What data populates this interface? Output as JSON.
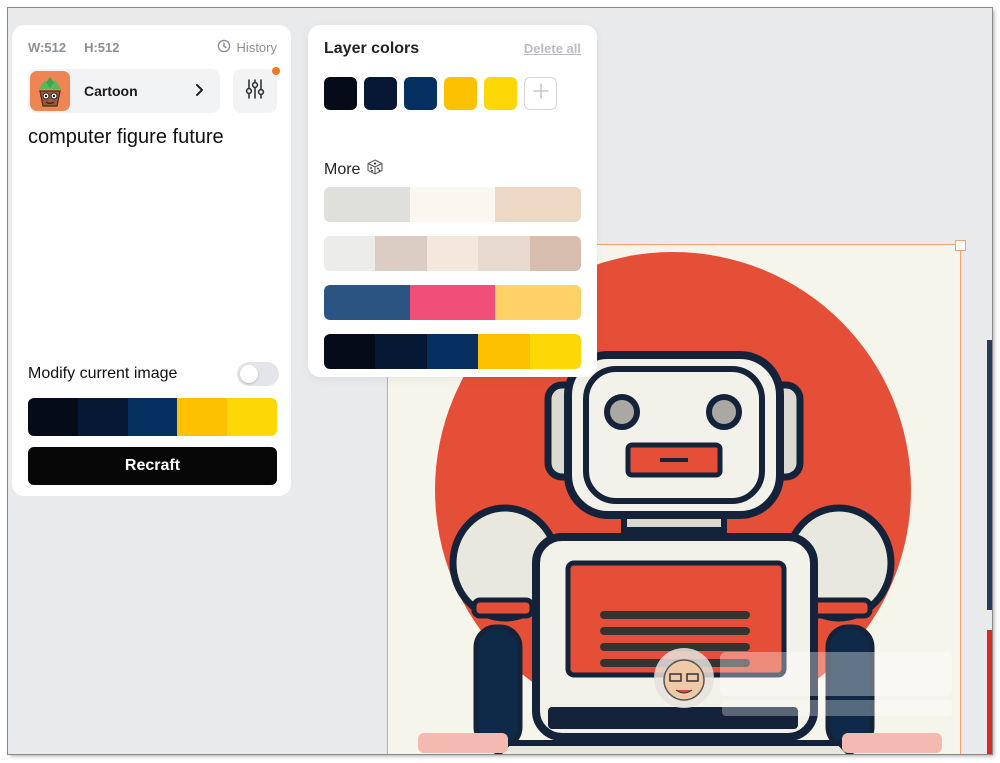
{
  "left_panel": {
    "width_label": "W:512",
    "height_label": "H:512",
    "history_label": "History",
    "style_label": "Cartoon",
    "prompt": "computer figure future",
    "modify_label": "Modify current image",
    "modify_toggle_on": false,
    "current_palette": [
      "#050b18",
      "#061833",
      "#05305f",
      "#fdc102",
      "#fed706"
    ],
    "recraft_label": "Recraft"
  },
  "colors_popover": {
    "title": "Layer colors",
    "delete_all_label": "Delete all",
    "layer_colors": [
      "#050b18",
      "#061833",
      "#05305f",
      "#fdc102",
      "#fed706"
    ],
    "more_label": "More",
    "more_palettes": [
      [
        "#dfe0db",
        "#faf6f0",
        "#ecd8c4"
      ],
      [
        "#ececea",
        "#dbcdc3",
        "#f4e8dd",
        "#e7d9cd",
        "#d6bdad"
      ],
      [
        "#2b5482",
        "#ef4f78",
        "#fed166"
      ],
      [
        "#050b18",
        "#061833",
        "#05305f",
        "#fdc102",
        "#fed706"
      ]
    ]
  },
  "icons": {
    "history": "clock-icon",
    "style_chevron": "chevron-right-icon",
    "settings": "sliders-icon",
    "add_color": "plus-icon",
    "more": "dice-icon"
  }
}
